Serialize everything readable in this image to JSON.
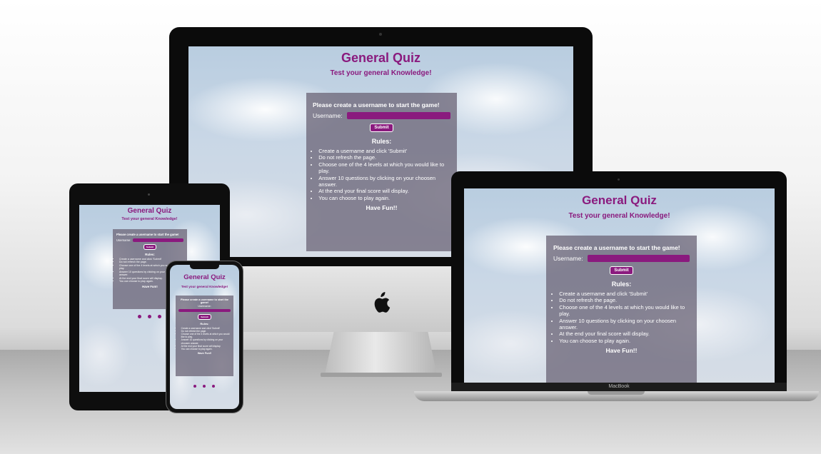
{
  "app": {
    "title": "General Quiz",
    "subtitle": "Test your general Knowledge!",
    "prompt": "Please create a username to start the game!",
    "username_label": "Username:",
    "submit_label": "Submit",
    "rules_heading": "Rules:",
    "rules": [
      "Create a username and click 'Submit'",
      "Do not refresh the page.",
      "Choose one of the 4 levels at which you would like to play.",
      "Answer 10 questions by clicking on your choosen answer.",
      "At the end your final score will display.",
      "You can choose to play again."
    ],
    "closing": "Have Fun!!"
  },
  "laptop": {
    "brand": "MacBook"
  },
  "icons": {
    "imac_logo": "apple-icon",
    "social": [
      "social-icon-1",
      "social-icon-2",
      "social-icon-3"
    ]
  },
  "colors": {
    "accent": "#8a1a7e",
    "panel": "#6e687a"
  }
}
